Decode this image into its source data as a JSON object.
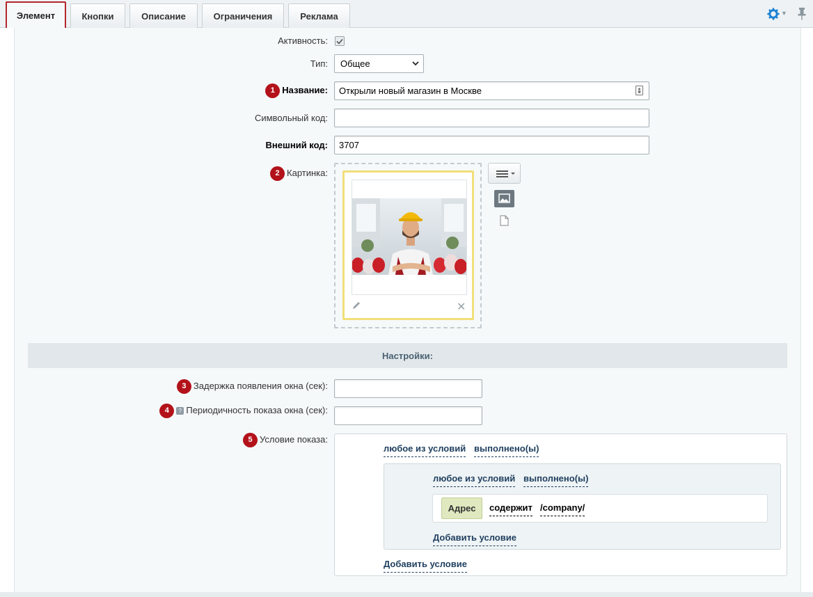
{
  "tabs": [
    {
      "label": "Элемент",
      "active": true
    },
    {
      "label": "Кнопки"
    },
    {
      "label": "Описание"
    },
    {
      "label": "Ограничения"
    },
    {
      "label": "Реклама"
    }
  ],
  "toolbar": {
    "settings_icon": "gear-icon",
    "pin_icon": "pin-icon",
    "accent_color": "#1e82d2"
  },
  "form": {
    "active": {
      "label": "Активность:",
      "checked": true
    },
    "type": {
      "label": "Тип:",
      "value": "Общее"
    },
    "name": {
      "badge": "1",
      "label": "Название:",
      "value": "Открыли новый магазин в Москве"
    },
    "code": {
      "label": "Символьный код:",
      "value": ""
    },
    "external_code": {
      "label": "Внешний код:",
      "value": "3707"
    },
    "picture": {
      "badge": "2",
      "label": "Картинка:"
    }
  },
  "settings": {
    "title": "Настройки:",
    "delay": {
      "badge": "3",
      "label": "Задержка появления окна (сек):",
      "value": ""
    },
    "period": {
      "badge": "4",
      "hint": "?",
      "label": "Периодичность показа окна (сек):",
      "value": ""
    },
    "condition": {
      "badge": "5",
      "label": "Условие показа:",
      "outer": {
        "any": "любое из условий",
        "done": "выполнено(ы)",
        "add": "Добавить условие"
      },
      "inner": {
        "any": "любое из условий",
        "done": "выполнено(ы)",
        "add": "Добавить условие"
      },
      "rule": {
        "field": "Адрес",
        "operator": "содержит",
        "value": "/company/"
      }
    }
  },
  "colors": {
    "badge": "#b3121a",
    "link": "#1f3f5f",
    "active_tab_border": "#b5262b",
    "frame": "#f2de7a"
  }
}
